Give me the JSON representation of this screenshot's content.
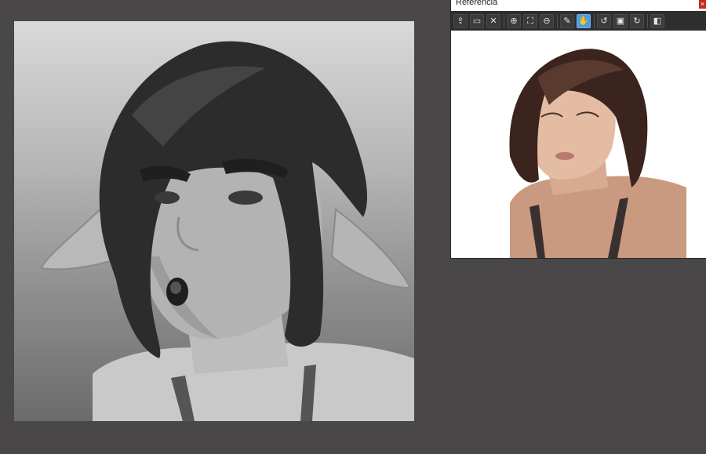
{
  "reference_window": {
    "title": "Referencia",
    "close_label": "×"
  },
  "toolbar": {
    "buttons": [
      {
        "name": "import-icon",
        "glyph": "⇪"
      },
      {
        "name": "open-folder-icon",
        "glyph": "▭"
      },
      {
        "name": "close-icon",
        "glyph": "✕"
      },
      {
        "name": "zoom-in-icon",
        "glyph": "⊕"
      },
      {
        "name": "fit-screen-icon",
        "glyph": "⛶"
      },
      {
        "name": "zoom-out-icon",
        "glyph": "⊖"
      },
      {
        "name": "eyedropper-icon",
        "glyph": "✎"
      },
      {
        "name": "hand-icon",
        "glyph": "✋",
        "active": true
      },
      {
        "name": "rotate-left-icon",
        "glyph": "↺"
      },
      {
        "name": "fit-icon",
        "glyph": "▣"
      },
      {
        "name": "rotate-right-icon",
        "glyph": "↻"
      },
      {
        "name": "flip-icon",
        "glyph": "◧"
      }
    ]
  },
  "colors": {
    "workspace_bg": "#4a4748",
    "toolbar_bg": "#2e2e2e",
    "active_tool": "#4a9ee8",
    "close_button": "#c42b1c"
  }
}
